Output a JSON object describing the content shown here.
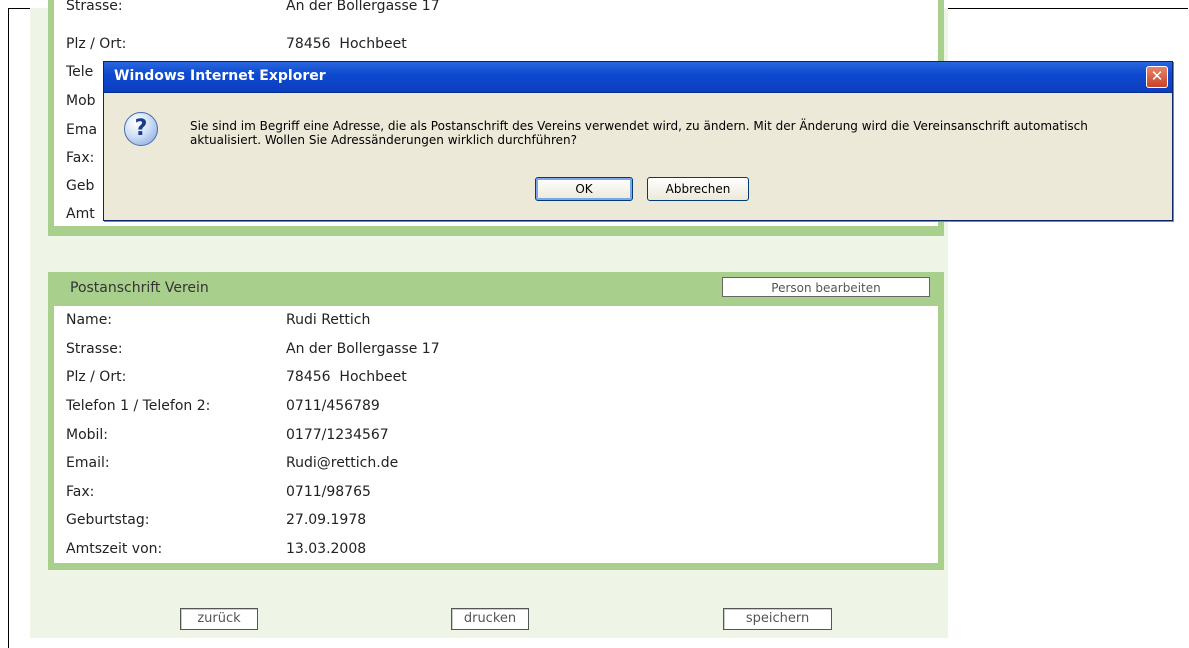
{
  "top_panel": {
    "rows": [
      {
        "label": "Strasse:",
        "value": "An der Bollergasse 17"
      },
      {
        "label": "Plz / Ort:",
        "value": "78456  Hochbeet"
      },
      {
        "label": "Tele",
        "value": ""
      },
      {
        "label": "Mob",
        "value": ""
      },
      {
        "label": "Ema",
        "value": ""
      },
      {
        "label": "Fax:",
        "value": ""
      },
      {
        "label": "Geb",
        "value": ""
      },
      {
        "label": "Amt",
        "value": ""
      }
    ]
  },
  "postanschrift": {
    "title": "Postanschrift Verein",
    "edit_button": "Person bearbeiten",
    "rows": [
      {
        "label": "Name:",
        "value": "Rudi Rettich"
      },
      {
        "label": "Strasse:",
        "value": "An der Bollergasse 17"
      },
      {
        "label": "Plz / Ort:",
        "value": "78456  Hochbeet"
      },
      {
        "label": "Telefon 1 / Telefon 2:",
        "value": "0711/456789"
      },
      {
        "label": "Mobil:",
        "value": "0177/1234567"
      },
      {
        "label": "Email:",
        "value": "Rudi@rettich.de"
      },
      {
        "label": "Fax:",
        "value": "0711/98765"
      },
      {
        "label": "Geburtstag:",
        "value": "27.09.1978"
      },
      {
        "label": "Amtszeit von:",
        "value": "13.03.2008"
      }
    ]
  },
  "footer": {
    "back": "zurück",
    "print": "drucken",
    "save": "speichern"
  },
  "dialog": {
    "title": "Windows Internet Explorer",
    "close_glyph": "✕",
    "icon": "question-icon",
    "icon_glyph": "?",
    "message": "Sie sind im Begriff eine Adresse, die als Postanschrift des Vereins verwendet wird, zu ändern. Mit der Änderung wird die Vereinsanschrift automatisch aktualisiert. Wollen Sie Adressänderungen wirklich durchführen?",
    "ok": "OK",
    "cancel": "Abbrechen"
  },
  "colors": {
    "panel_border": "#a9cf8c",
    "page_bg": "#eef5e6",
    "titlebar": "#0d4ad0"
  }
}
